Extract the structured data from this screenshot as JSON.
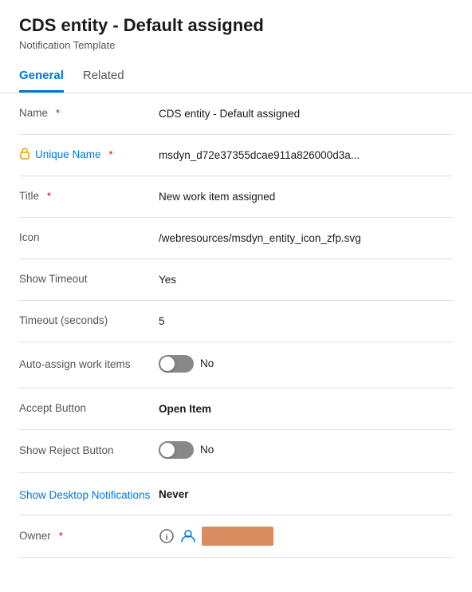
{
  "header": {
    "title": "CDS entity - Default assigned",
    "subtitle": "Notification Template"
  },
  "tabs": [
    {
      "id": "general",
      "label": "General",
      "active": true
    },
    {
      "id": "related",
      "label": "Related",
      "active": false
    }
  ],
  "fields": [
    {
      "id": "name",
      "label": "Name",
      "labelColor": "normal",
      "required": true,
      "hasLock": false,
      "value": "CDS entity - Default assigned",
      "type": "text",
      "bold": false
    },
    {
      "id": "unique-name",
      "label": "Unique Name",
      "labelColor": "blue",
      "required": true,
      "hasLock": true,
      "value": "msdyn_d72e37355dcae911a826000d3a...",
      "type": "text",
      "bold": false
    },
    {
      "id": "title",
      "label": "Title",
      "labelColor": "normal",
      "required": true,
      "hasLock": false,
      "value": "New work item assigned",
      "type": "text",
      "bold": false
    },
    {
      "id": "icon",
      "label": "Icon",
      "labelColor": "normal",
      "required": false,
      "hasLock": false,
      "value": "/webresources/msdyn_entity_icon_zfp.svg",
      "type": "text",
      "bold": false
    },
    {
      "id": "show-timeout",
      "label": "Show Timeout",
      "labelColor": "normal",
      "required": false,
      "hasLock": false,
      "value": "Yes",
      "type": "text",
      "bold": false
    },
    {
      "id": "timeout-seconds",
      "label": "Timeout (seconds)",
      "labelColor": "normal",
      "required": false,
      "hasLock": false,
      "value": "5",
      "type": "text",
      "bold": false
    },
    {
      "id": "auto-assign",
      "label": "Auto-assign work items",
      "labelColor": "normal",
      "required": false,
      "hasLock": false,
      "value": "No",
      "type": "toggle",
      "bold": false
    },
    {
      "id": "accept-button",
      "label": "Accept Button",
      "labelColor": "normal",
      "required": false,
      "hasLock": false,
      "value": "Open Item",
      "type": "text",
      "bold": true
    },
    {
      "id": "show-reject-button",
      "label": "Show Reject Button",
      "labelColor": "normal",
      "required": false,
      "hasLock": false,
      "value": "No",
      "type": "toggle",
      "bold": false
    },
    {
      "id": "show-desktop-notifications",
      "label": "Show Desktop Notifications",
      "labelColor": "blue",
      "required": false,
      "hasLock": false,
      "value": "Never",
      "type": "text",
      "bold": true
    },
    {
      "id": "owner",
      "label": "Owner",
      "labelColor": "normal",
      "required": true,
      "hasLock": false,
      "value": "",
      "type": "owner",
      "bold": false
    }
  ],
  "colors": {
    "accent": "#0078d4",
    "tab_active": "#0078d4",
    "required": "#cc0000",
    "owner_box": "#d98c5f"
  }
}
